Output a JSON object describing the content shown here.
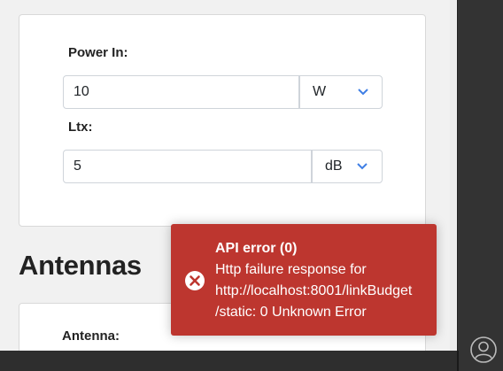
{
  "power_card": {
    "power_in": {
      "label": "Power In:",
      "value": "10",
      "unit": "W"
    },
    "ltx": {
      "label": "Ltx:",
      "value": "5",
      "unit": "dB"
    }
  },
  "antennas_section": {
    "title": "Antennas",
    "antenna_label": "Antenna:"
  },
  "toast": {
    "title": "API error (0)",
    "message_lines": [
      "Http failure response for",
      "http://localhost:8001/linkBudget",
      "/static: 0 Unknown Error"
    ],
    "icon": "error-circle-x-icon",
    "color": "#bd362f"
  },
  "taskbar": {
    "icon": "account-icon"
  },
  "colors": {
    "chevron": "#3f7fe5",
    "page_bg": "#f1f1f1",
    "dark_panel": "#333333"
  }
}
